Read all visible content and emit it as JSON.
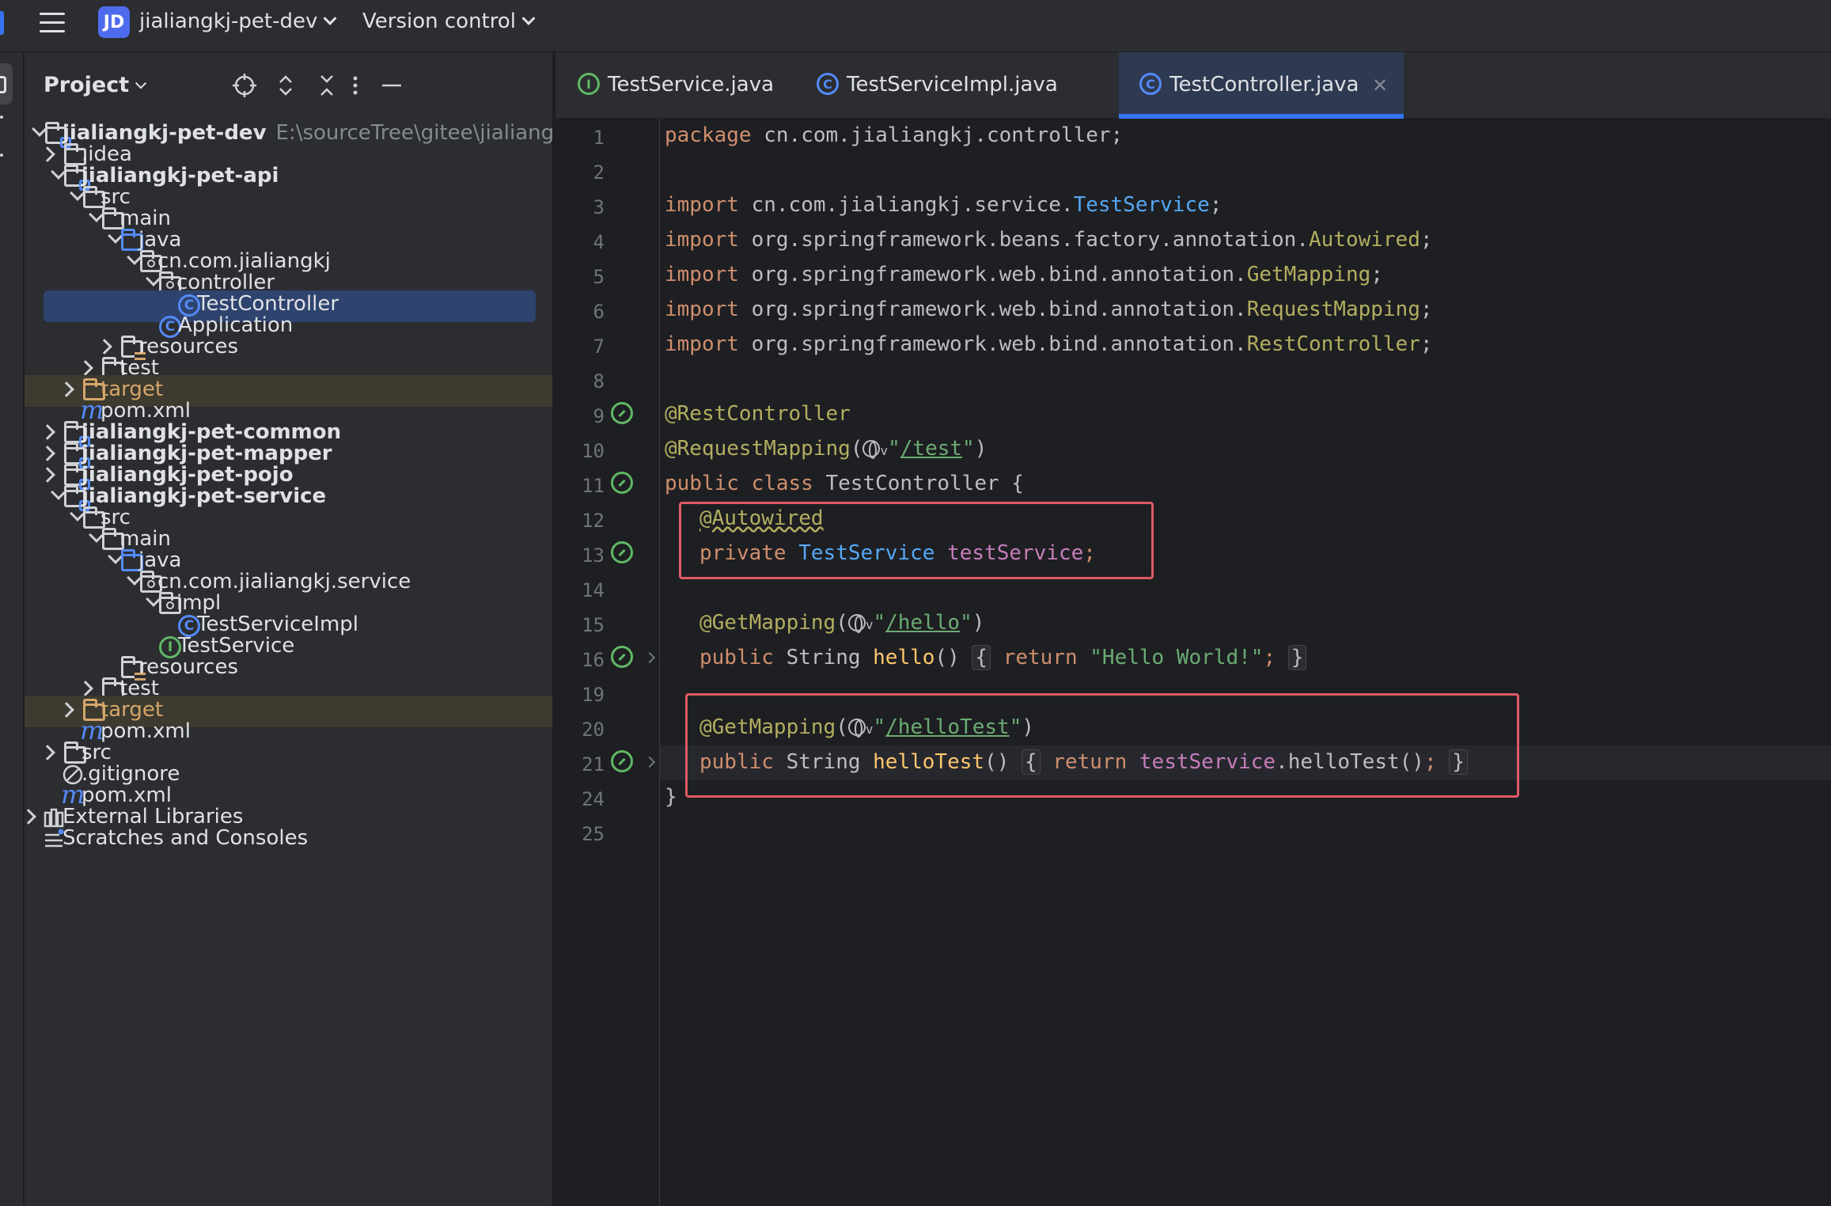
{
  "topbar": {
    "project_badge": "JD",
    "project_name": "jialiangkj-pet-dev",
    "vcs_label": "Version control"
  },
  "project_panel": {
    "title": "Project",
    "tree": [
      {
        "label": "jialiangkj-pet-dev",
        "path": "E:\\sourceTree\\gitee\\jialiang"
      },
      {
        "label": ".idea"
      },
      {
        "label": "jialiangkj-pet-api"
      },
      {
        "label": "src"
      },
      {
        "label": "main"
      },
      {
        "label": "java"
      },
      {
        "label": "cn.com.jialiangkj"
      },
      {
        "label": "controller"
      },
      {
        "label": "TestController"
      },
      {
        "label": "Application"
      },
      {
        "label": "resources"
      },
      {
        "label": "test"
      },
      {
        "label": "target"
      },
      {
        "label": "pom.xml"
      },
      {
        "label": "jialiangkj-pet-common"
      },
      {
        "label": "jialiangkj-pet-mapper"
      },
      {
        "label": "jialiangkj-pet-pojo"
      },
      {
        "label": "jialiangkj-pet-service"
      },
      {
        "label": "src"
      },
      {
        "label": "main"
      },
      {
        "label": "java"
      },
      {
        "label": "cn.com.jialiangkj.service"
      },
      {
        "label": "impl"
      },
      {
        "label": "TestServiceImpl"
      },
      {
        "label": "TestService"
      },
      {
        "label": "resources"
      },
      {
        "label": "test"
      },
      {
        "label": "target"
      },
      {
        "label": "pom.xml"
      },
      {
        "label": "src"
      },
      {
        "label": ".gitignore"
      },
      {
        "label": "pom.xml"
      },
      {
        "label": "External Libraries"
      },
      {
        "label": "Scratches and Consoles"
      }
    ]
  },
  "tabs": [
    {
      "label": "TestService.java",
      "icon": "I",
      "active": false
    },
    {
      "label": "TestServiceImpl.java",
      "icon": "C",
      "active": false
    },
    {
      "label": "TestController.java",
      "icon": "C",
      "active": true
    }
  ],
  "editor": {
    "line_numbers": [
      "1",
      "2",
      "3",
      "4",
      "5",
      "6",
      "7",
      "8",
      "9",
      "10",
      "11",
      "12",
      "13",
      "14",
      "15",
      "16",
      "19",
      "20",
      "21",
      "24",
      "25"
    ],
    "code": {
      "l1_kw": "package",
      "l1_rest": " cn.com.jialiangkj.controller;",
      "l3_kw": "import",
      "l3_pkg": " cn.com.jialiangkj.service.",
      "l3_cls": "TestService",
      "l3_end": ";",
      "l4_kw": "import",
      "l4_pkg": " org.springframework.beans.factory.annotation.",
      "l4_cls": "Autowired",
      "l4_end": ";",
      "l5_kw": "import",
      "l5_pkg": " org.springframework.web.bind.annotation.",
      "l5_cls": "GetMapping",
      "l5_end": ";",
      "l6_kw": "import",
      "l6_pkg": " org.springframework.web.bind.annotation.",
      "l6_cls": "RequestMapping",
      "l6_end": ";",
      "l7_kw": "import",
      "l7_pkg": " org.springframework.web.bind.annotation.",
      "l7_cls": "RestController",
      "l7_end": ";",
      "l9_ann": "@RestController",
      "l10_ann": "@RequestMapping",
      "l10_open": "(",
      "l10_v": "v",
      "l10_q1": "\"",
      "l10_url": "/test",
      "l10_q2": "\"",
      "l10_close": ")",
      "l11_kw": "public class",
      "l11_cls": " TestController",
      "l11_brace": " {",
      "l12_ann": "@Autowired",
      "l13_kw": "private",
      "l13_type": " TestService",
      "l13_fld": " testService",
      "l13_end": ";",
      "l15_ann": "@GetMapping",
      "l15_open": "(",
      "l15_v": "v",
      "l15_q1": "\"",
      "l15_url": "/hello",
      "l15_q2": "\"",
      "l15_close": ")",
      "l16_kw": "public",
      "l16_type": " String",
      "l16_fn": " hello",
      "l16_paren": "() ",
      "l16_ob": "{",
      "l16_ret": " return",
      "l16_str": " \"Hello World!\"",
      "l16_semi": ";",
      "l16_cb": "}",
      "l20_ann": "@GetMapping",
      "l20_open": "(",
      "l20_v": "v",
      "l20_q1": "\"",
      "l20_url": "/helloTest",
      "l20_q2": "\"",
      "l20_close": ")",
      "l21_kw": "public",
      "l21_type": " String",
      "l21_fn": " helloTest",
      "l21_paren": "() ",
      "l21_ob": "{",
      "l21_ret": " return",
      "l21_fld": " testService",
      "l21_call": ".helloTest()",
      "l21_semi": ";",
      "l21_cb": "}",
      "l24": "}"
    }
  },
  "colors": {
    "accent": "#3574f0",
    "highlight_box": "#e05a66",
    "selection": "#2e436e"
  }
}
